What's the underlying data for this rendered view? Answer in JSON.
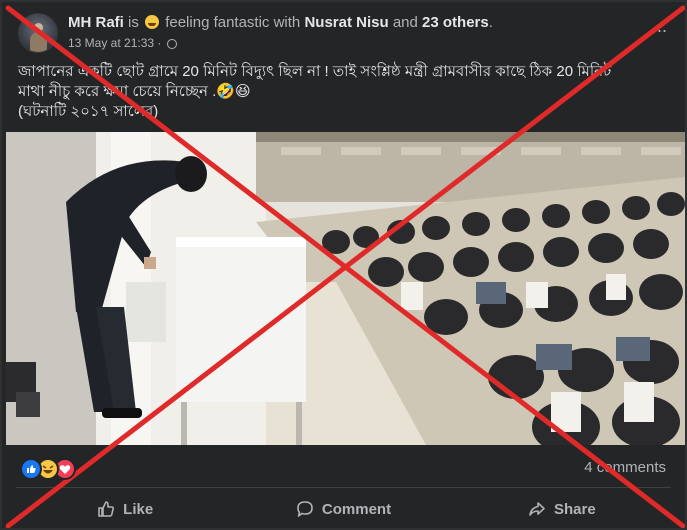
{
  "header": {
    "author": "MH Rafi",
    "is_text": "is",
    "feeling_text": "feeling fantastic with",
    "tagged_person": "Nusrat Nisu",
    "and_text": "and",
    "others_text": "23 others",
    "period": ".",
    "timestamp": "13 May at 21:33 ·",
    "more_icon": "···"
  },
  "post": {
    "line1": "জাপানের একটি ছোট গ্রামে 20 মিনিট বিদ্যুৎ ছিল না ! তাই সংশ্লিষ্ঠ মন্ত্রী গ্রামবাসীর কাছে ঠিক 20 মিনিট",
    "line2": "মাথা নীচু করে ক্ষমা চেয়ে নিচ্ছেন .🤣😆",
    "line3": "(ঘটনাটি ২০১৭ সালের)"
  },
  "reactions": {
    "icons": [
      "like-icon",
      "haha-icon",
      "love-icon"
    ],
    "comments": "4 comments"
  },
  "actions": {
    "like": "Like",
    "comment": "Comment",
    "share": "Share"
  },
  "colors": {
    "background": "#242526",
    "text": "#e4e6eb",
    "muted": "#b0b3b8",
    "cross": "#e02a2a"
  }
}
